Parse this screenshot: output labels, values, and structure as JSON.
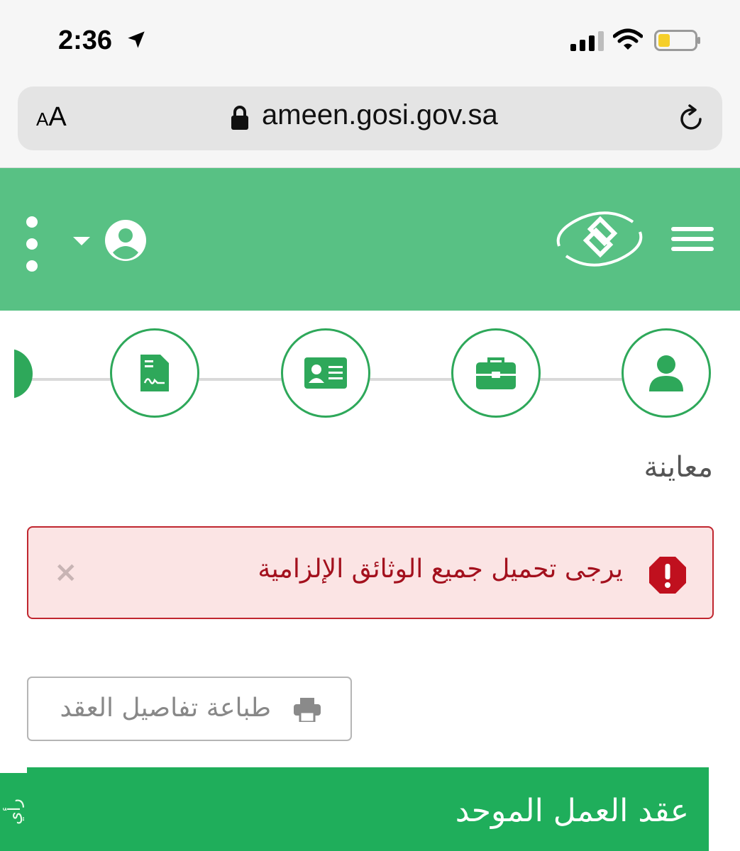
{
  "status_bar": {
    "time": "2:36",
    "icons": [
      "location-arrow-icon",
      "cell-signal-icon",
      "wifi-icon",
      "battery-icon"
    ]
  },
  "browser": {
    "text_size_label_small": "A",
    "text_size_label_large": "A",
    "url": "ameen.gosi.gov.sa"
  },
  "header": {
    "brand": "GOSI",
    "colors": {
      "background": "#58c184"
    }
  },
  "stepper": {
    "steps": [
      {
        "icon": "person-icon"
      },
      {
        "icon": "briefcase-icon"
      },
      {
        "icon": "id-card-icon"
      },
      {
        "icon": "signed-document-icon"
      },
      {
        "icon": "partial-step"
      }
    ]
  },
  "page": {
    "section_title": "معاينة",
    "alert": {
      "message": "يرجى تحميل جميع الوثائق الإلزامية",
      "close": "×"
    },
    "print_button": "طباعة تفاصيل العقد",
    "contract_title": "عقد العمل الموحد",
    "feedback_tab": "رأي"
  },
  "colors": {
    "primary_green": "#1fae5b",
    "step_green": "#2ea85a",
    "alert_red": "#c0262f",
    "alert_bg": "#fbe4e4"
  }
}
